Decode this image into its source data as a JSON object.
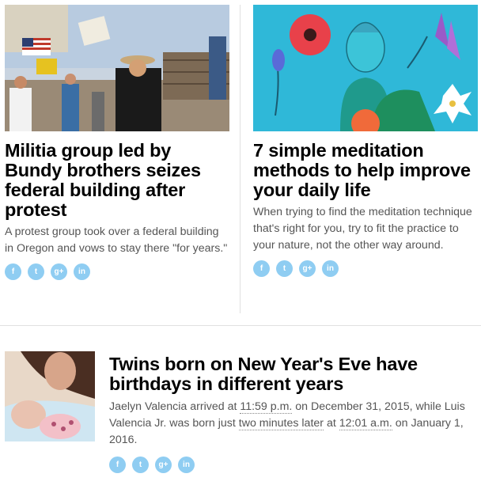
{
  "articles": [
    {
      "headline": "Militia group led by Bundy brothers seizes federal building after protest",
      "summary": "A protest group took over a federal building in Oregon and vows to stay there \"for years.\""
    },
    {
      "headline": "7 simple meditation methods to help improve your daily life",
      "summary": "When trying to find the meditation technique that's right for you, try to fit the practice to your nature, not the other way around."
    }
  ],
  "featured": {
    "headline": "Twins born on New Year's Eve have birthdays in different years",
    "summary_parts": {
      "a": "Jaelyn Valencia arrived at ",
      "b": "11:59 p.m.",
      "c": " on December 31, 2015, while Luis Valencia Jr. was born just ",
      "d": "two minutes later",
      "e": " at ",
      "f": "12:01 a.m.",
      "g": " on January 1, 2016."
    }
  },
  "share": {
    "facebook": "f",
    "twitter": "t",
    "googleplus": "g+",
    "linkedin": "in"
  },
  "colors": {
    "share_icon": "#8fcdf2",
    "headline": "#000000",
    "summary": "#555555",
    "divider": "#e0e0e0"
  },
  "icons": [
    "facebook-icon",
    "twitter-icon",
    "google-plus-icon",
    "linkedin-icon"
  ]
}
